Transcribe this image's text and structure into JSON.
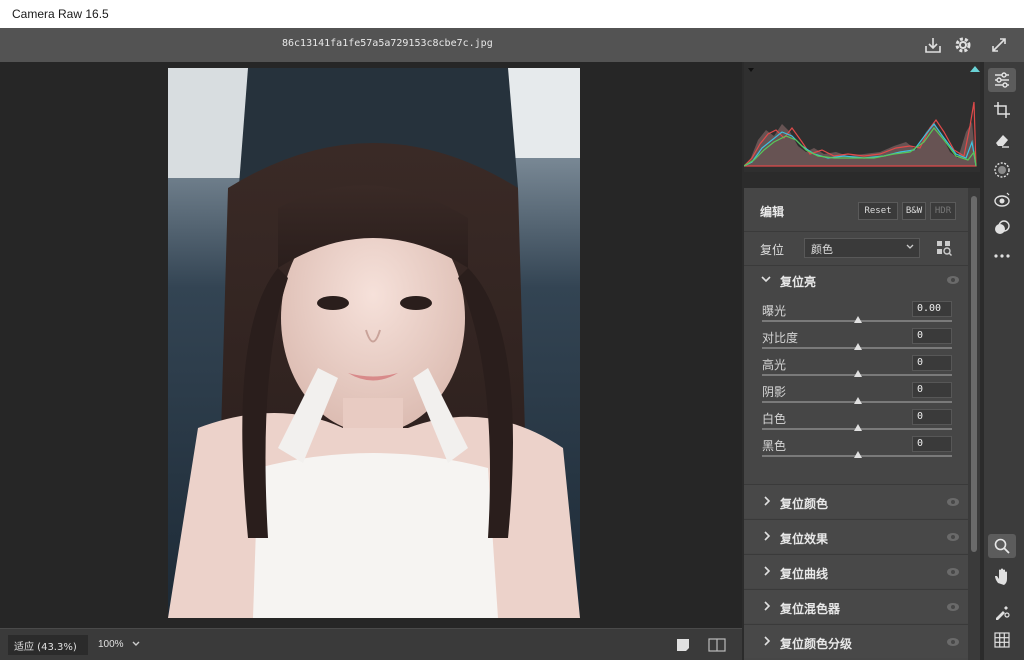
{
  "window": {
    "title": "Camera Raw 16.5"
  },
  "file": {
    "name": "86c13141fa1fe57a5a729153c8cbe7c.jpg"
  },
  "topbar_icons": [
    "save-icon",
    "gear-icon",
    "fullscreen-icon"
  ],
  "bottom": {
    "fit_label": "适应 (43.3%)",
    "zoom_label": "100%"
  },
  "panel": {
    "title": "编辑",
    "buttons": {
      "reset": "Reset",
      "bw": "B&W",
      "hdr": "HDR"
    },
    "reset_label": "复位",
    "reset_select": "颜色",
    "open_section": {
      "title": "复位亮",
      "sliders": [
        {
          "label": "曝光",
          "value": "0.00"
        },
        {
          "label": "对比度",
          "value": "0"
        },
        {
          "label": "高光",
          "value": "0"
        },
        {
          "label": "阴影",
          "value": "0"
        },
        {
          "label": "白色",
          "value": "0"
        },
        {
          "label": "黑色",
          "value": "0"
        }
      ]
    },
    "closed_sections": [
      "复位颜色",
      "复位效果",
      "复位曲线",
      "复位混色器",
      "复位颜色分级"
    ]
  },
  "tools": [
    "sliders-icon",
    "crop-icon",
    "eraser-icon",
    "mask-icon",
    "redeye-icon",
    "presets-icon",
    "more-icon",
    "zoom-icon",
    "hand-icon",
    "sampler-icon",
    "grid-icon"
  ],
  "colors": {
    "panel_bg": "#464646",
    "canvas_bg": "#262626",
    "toolbar_bg": "#535353"
  }
}
